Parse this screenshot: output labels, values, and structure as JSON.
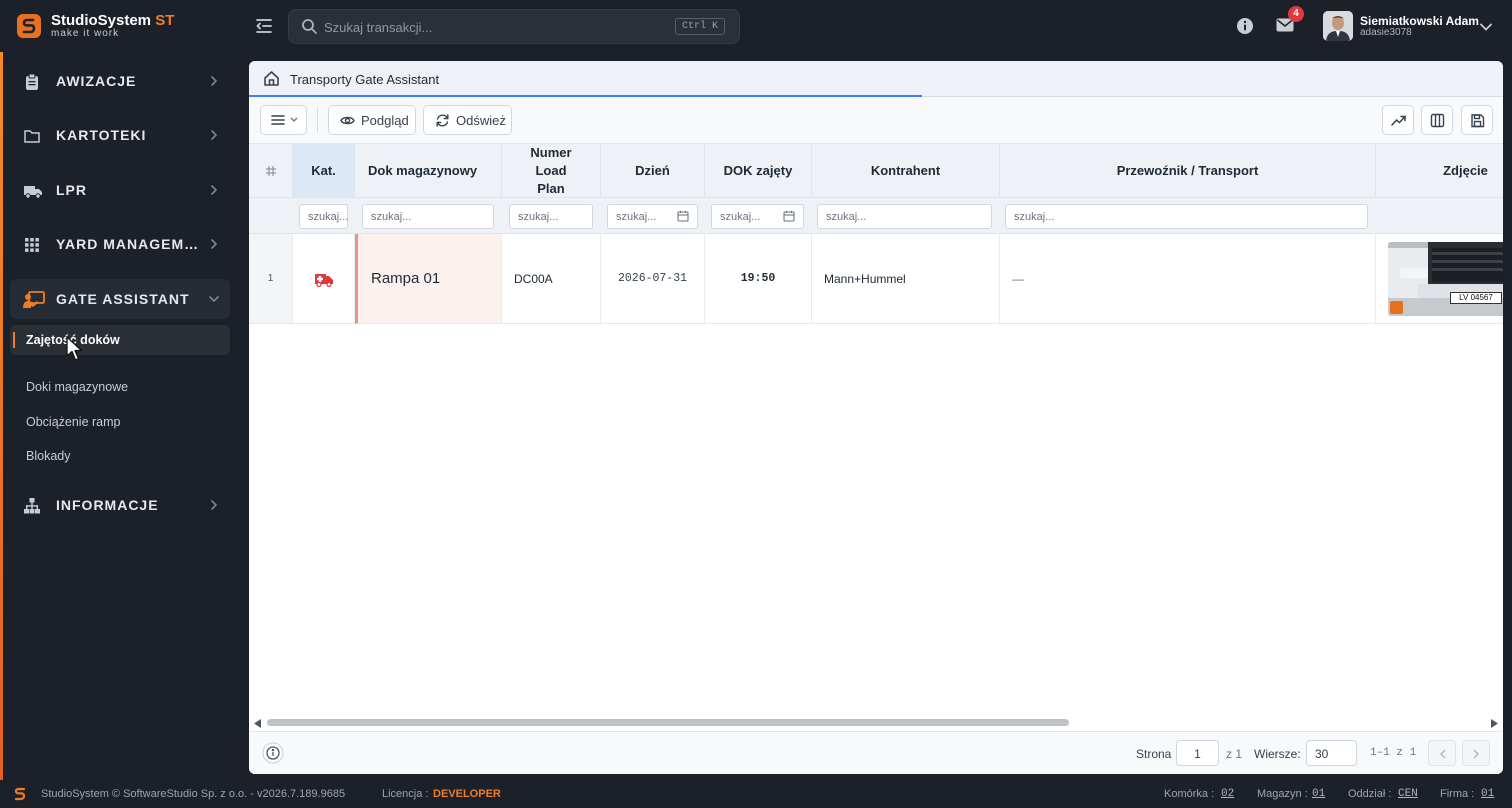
{
  "app": {
    "name": "StudioSystem",
    "name_suffix": "ST",
    "tagline": "make it work",
    "accent": "#f07c25"
  },
  "search": {
    "placeholder": "Szukaj transakcji...",
    "shortcut": "Ctrl K"
  },
  "header": {
    "mail_badge": "4",
    "user_name": "Siemiatkowski Adam",
    "user_login": "adasie3078"
  },
  "sidebar": {
    "items": [
      {
        "label": "AWIZACJE",
        "icon": "clipboard-icon"
      },
      {
        "label": "KARTOTEKI",
        "icon": "folder-icon"
      },
      {
        "label": "LPR",
        "icon": "truck-icon"
      },
      {
        "label": "YARD MANAGEMENT",
        "icon": "grid-icon"
      },
      {
        "label": "GATE ASSISTANT",
        "icon": "gate-assistant-icon",
        "expanded": true
      },
      {
        "label": "INFORMACJE",
        "icon": "sitemap-icon"
      }
    ],
    "subitems": [
      {
        "label": "Zajętość doków",
        "active": true
      },
      {
        "label": "Doki magazynowe"
      },
      {
        "label": "Obciążenie ramp"
      },
      {
        "label": "Blokady"
      }
    ]
  },
  "tab": {
    "title": "Transporty Gate Assistant"
  },
  "toolbar": {
    "preview_label": "Podgląd",
    "refresh_label": "Odśwież"
  },
  "table": {
    "columns": [
      "#",
      "Kat.",
      "Dok magazynowy",
      "Numer Load Plan",
      "Dzień",
      "DOK zajęty",
      "Kontrahent",
      "Przewoźnik / Transport",
      "Zdjęcie"
    ],
    "filter_placeholders": [
      "szukaj...",
      "szukaj...",
      "szukaj...",
      "szukaj...",
      "szukaj...",
      "szukaj...",
      "szukaj..."
    ],
    "rows": [
      {
        "no": "1",
        "category_icon": "ambulance-icon",
        "dock": "Rampa 01",
        "load_plan": "DC00A",
        "day": "2026-07-31",
        "dock_time": "19:50",
        "contractor": "Mann+Hummel",
        "carrier": "—",
        "plate": "LV 04567"
      }
    ]
  },
  "pager": {
    "page_label": "Strona",
    "page": "1",
    "of_pages": "z 1",
    "rows_label": "Wiersze:",
    "rows_per_page": "30",
    "range": "1–1 z 1"
  },
  "footer": {
    "copyright": "StudioSystem © SoftwareStudio Sp. z o.o. - v2026.7.189.9685",
    "license_label": "Licencja :",
    "license": "DEVELOPER",
    "cell_label": "Komórka :",
    "cell": "02",
    "warehouse_label": "Magazyn :",
    "warehouse": "01",
    "branch_label": "Oddział :",
    "branch": "CEN",
    "company_label": "Firma :",
    "company": "01"
  }
}
